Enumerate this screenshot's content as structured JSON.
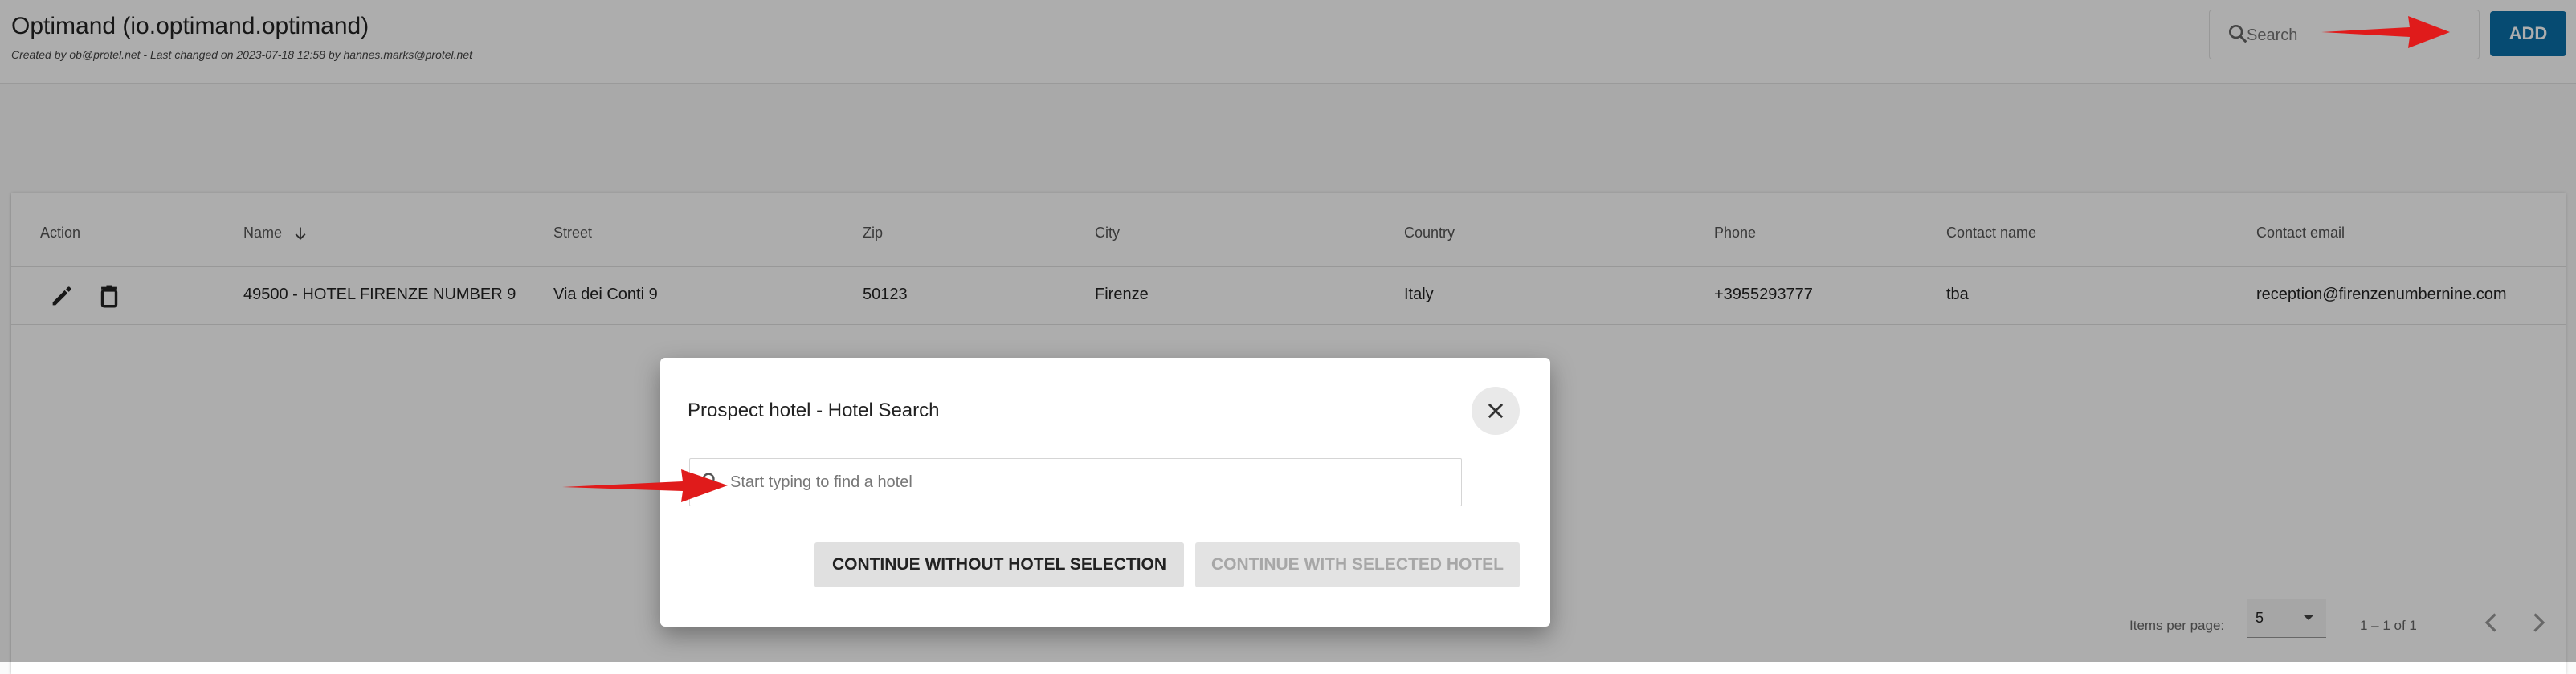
{
  "header": {
    "title": "Optimand (io.optimand.optimand)",
    "meta": "Created by ob@protel.net - Last changed on 2023-07-18 12:58 by hannes.marks@protel.net",
    "search_placeholder": "Search",
    "add_label": "ADD"
  },
  "table": {
    "columns": [
      "Action",
      "Name",
      "Street",
      "Zip",
      "City",
      "Country",
      "Phone",
      "Contact name",
      "Contact email"
    ],
    "sorted_column": "Name",
    "sort_direction": "descending",
    "rows": [
      {
        "name": "49500 - HOTEL FIRENZE NUMBER 9",
        "street": "Via dei Conti 9",
        "zip": "50123",
        "city": "Firenze",
        "country": "Italy",
        "phone": "+3955293777",
        "contact_name": "tba",
        "contact_email": "reception@firenzenumbernine.com"
      }
    ],
    "row_actions": [
      "edit-icon",
      "delete-icon"
    ]
  },
  "paginator": {
    "items_per_page_label": "Items per page:",
    "page_size": "5",
    "range": "1 – 1 of 1"
  },
  "dialog": {
    "title": "Prospect hotel - Hotel Search",
    "input_placeholder": "Start typing to find a hotel",
    "continue_without_label": "CONTINUE WITHOUT HOTEL SELECTION",
    "continue_with_label": "CONTINUE WITH SELECTED HOTEL"
  },
  "colors": {
    "accent": "#0a6fa8",
    "backdrop": "rgba(0,0,0,0.32)",
    "annotation": "#e01b1b"
  }
}
